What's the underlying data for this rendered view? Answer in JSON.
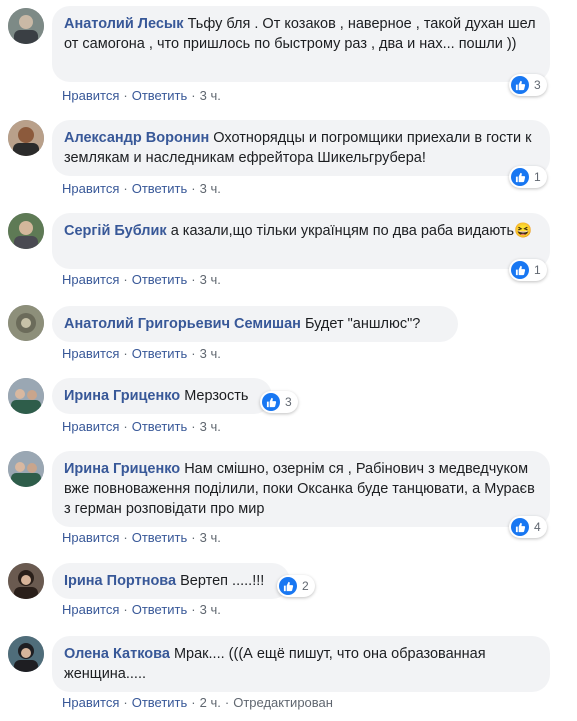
{
  "actions": {
    "like": "Нравится",
    "reply": "Ответить",
    "separator": "·",
    "edited": "Отредактирован"
  },
  "comments": [
    {
      "author": "Анатолий Лесык",
      "text": "Тьфу бля . От козаков , наверное , такой духан шел от самогона , что пришлось по быстрому раз , два и нах... пошли ))",
      "time": "3 ч.",
      "likes": "3"
    },
    {
      "author": "Александр Воронин",
      "text": "Охотнорядцы и погромщики приехали в гости к землякам и наследникам ефрейтора Шикельгрубера!",
      "time": "3 ч.",
      "likes": "1"
    },
    {
      "author": "Сергій Бублик",
      "text": "а казали,що тільки українцям по два раба видають😆",
      "time": "3 ч.",
      "likes": "1"
    },
    {
      "author": "Анатолий Григорьевич Семишан",
      "text": "Будет \"аншлюс\"?",
      "time": "3 ч.",
      "likes": ""
    },
    {
      "author": "Ирина Гриценко",
      "text": "Мерзость",
      "time": "3 ч.",
      "likes": "3"
    },
    {
      "author": "Ирина Гриценко",
      "text": "Нам смішно, озернім ся , Рабінович з медведчуком вже повноваження поділили, поки Оксанка буде танцювати, а Мураєв з герман розповідати про мир",
      "time": "3 ч.",
      "likes": "4"
    },
    {
      "author": "Ірина Портнова",
      "text": "Вертеп .....!!!",
      "time": "3 ч.",
      "likes": "2"
    },
    {
      "author": "Олена Каткова",
      "text": "Мрак.... (((А ещё пишут, что она образованная женщина.....",
      "time": "2 ч.",
      "likes": "",
      "edited": true
    }
  ],
  "colors": {
    "author": "#385898",
    "bubble": "#f2f3f5",
    "like_badge": "#1877f2"
  }
}
